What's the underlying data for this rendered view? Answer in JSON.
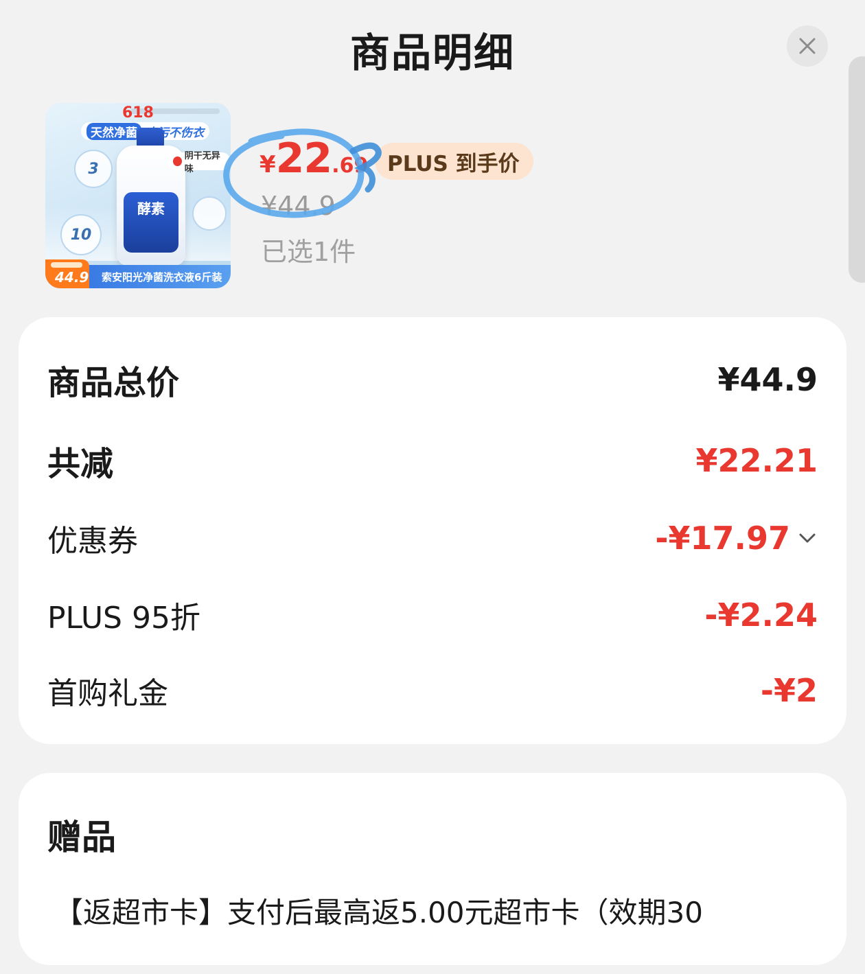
{
  "header": {
    "title": "商品明细"
  },
  "product": {
    "thumb": {
      "badge_618": "618",
      "banner_a": "天然净菌",
      "banner_b": "去污不伤衣",
      "tag": "阴干无异味",
      "bubble_3": "3",
      "bubble_10": "10",
      "label": "酵素",
      "footer": "索安阳光净菌洗衣液6斤装",
      "price_tag": "44.9"
    },
    "price_currency": "¥",
    "price_integer": "22",
    "price_decimal": ".69",
    "plus_label": "PLUS 到手价",
    "original_price": "¥44.9",
    "selected_count": "已选1件"
  },
  "summary": {
    "rows": [
      {
        "label": "商品总价",
        "value": "¥44.9"
      },
      {
        "label": "共减",
        "value": "¥22.21"
      },
      {
        "label": "优惠券",
        "value": "-¥17.97"
      },
      {
        "label": "PLUS 95折",
        "value": "-¥2.24"
      },
      {
        "label": "首购礼金",
        "value": "-¥2"
      }
    ]
  },
  "gift": {
    "title": "赠品",
    "text": "【返超市卡】支付后最高返5.00元超市卡（效期30"
  },
  "colors": {
    "accent_red": "#e8382f",
    "plus_badge_bg": "#fce4d0",
    "annotation_blue": "#5aa9ec"
  },
  "icons": [
    "close-icon",
    "chevron-down-icon"
  ]
}
